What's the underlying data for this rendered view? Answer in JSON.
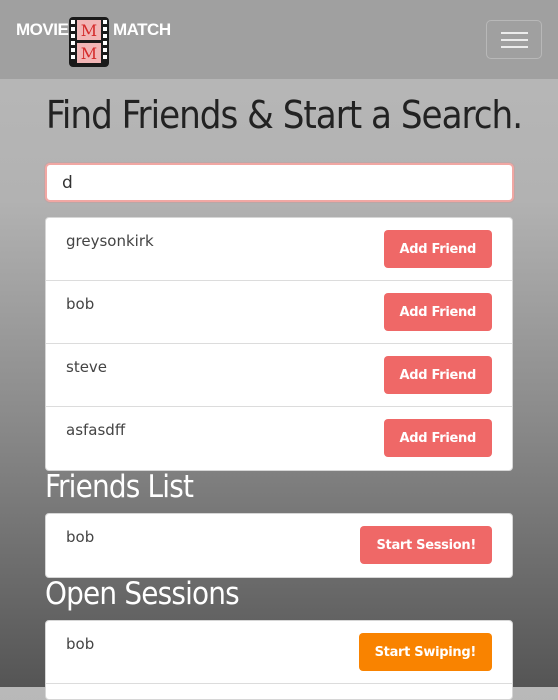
{
  "navbar": {
    "brand_left": "MOVIE",
    "brand_right": "MATCH",
    "logo_letters": [
      "M",
      "M"
    ],
    "menu_icon": "hamburger-icon"
  },
  "page": {
    "title": "Find Friends & Start a Search."
  },
  "search": {
    "value": "d"
  },
  "results": [
    {
      "name": "greysonkirk",
      "action": "Add Friend"
    },
    {
      "name": "bob",
      "action": "Add Friend"
    },
    {
      "name": "steve",
      "action": "Add Friend"
    },
    {
      "name": "asfasdff",
      "action": "Add Friend"
    }
  ],
  "friends": {
    "title": "Friends List",
    "items": [
      {
        "name": "bob",
        "action": "Start Session!"
      }
    ]
  },
  "sessions": {
    "title": "Open Sessions",
    "items": [
      {
        "name": "bob",
        "action": "Start Swiping!"
      }
    ]
  },
  "colors": {
    "accent_red": "#ef6867",
    "accent_orange": "#f98300",
    "navbar": "#a0a0a0"
  }
}
